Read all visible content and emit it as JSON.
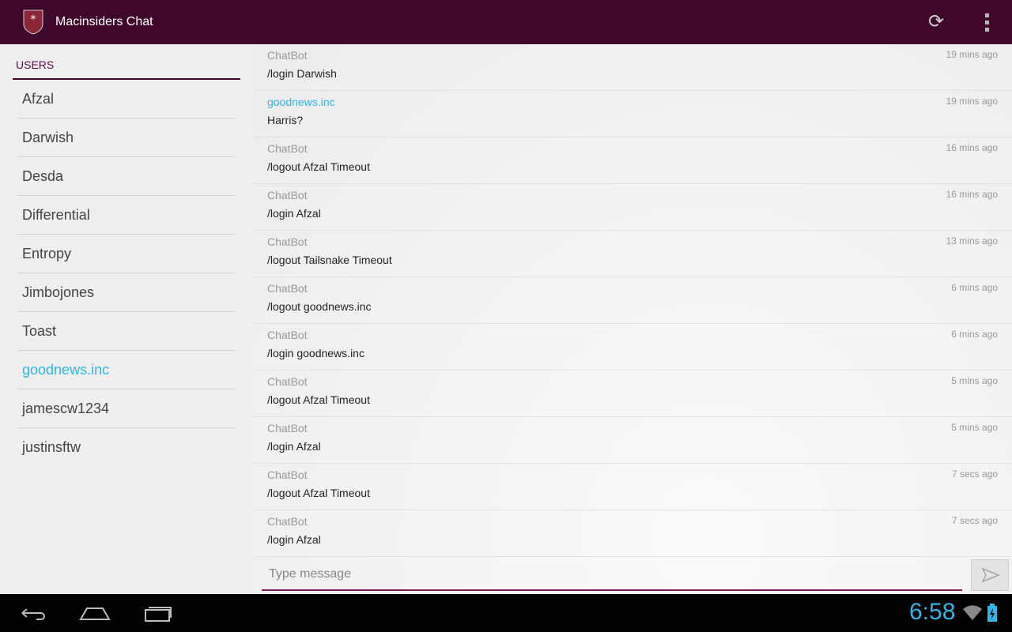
{
  "app": {
    "title": "Macinsiders Chat",
    "logo_icon": "shield-asterisk-icon"
  },
  "sidebar": {
    "header": "USERS",
    "users": [
      {
        "name": "Afzal"
      },
      {
        "name": "Darwish"
      },
      {
        "name": "Desda"
      },
      {
        "name": "Differential"
      },
      {
        "name": "Entropy"
      },
      {
        "name": "Jimbojones"
      },
      {
        "name": "Toast"
      },
      {
        "name": "goodnews.inc",
        "highlight": true
      },
      {
        "name": "jamescw1234"
      },
      {
        "name": "justinsftw"
      }
    ]
  },
  "messages": [
    {
      "author": "ChatBot",
      "time": "19 mins ago",
      "text": "/login Darwish"
    },
    {
      "author": "goodnews.inc",
      "time": "19 mins ago",
      "text": "Harris?",
      "highlight": true
    },
    {
      "author": "ChatBot",
      "time": "16 mins ago",
      "text": "/logout Afzal Timeout"
    },
    {
      "author": "ChatBot",
      "time": "16 mins ago",
      "text": "/login Afzal"
    },
    {
      "author": "ChatBot",
      "time": "13 mins ago",
      "text": "/logout Tailsnake Timeout"
    },
    {
      "author": "ChatBot",
      "time": "6 mins ago",
      "text": "/logout goodnews.inc"
    },
    {
      "author": "ChatBot",
      "time": "6 mins ago",
      "text": "/login goodnews.inc"
    },
    {
      "author": "ChatBot",
      "time": "5 mins ago",
      "text": "/logout Afzal Timeout"
    },
    {
      "author": "ChatBot",
      "time": "5 mins ago",
      "text": "/login Afzal"
    },
    {
      "author": "ChatBot",
      "time": "7 secs ago",
      "text": "/logout Afzal Timeout"
    },
    {
      "author": "ChatBot",
      "time": "7 secs ago",
      "text": "/login Afzal"
    }
  ],
  "composer": {
    "placeholder": "Type message",
    "value": ""
  },
  "status": {
    "clock": "6:58"
  },
  "colors": {
    "bar": "#3f082a",
    "accent": "#33b5e5"
  }
}
